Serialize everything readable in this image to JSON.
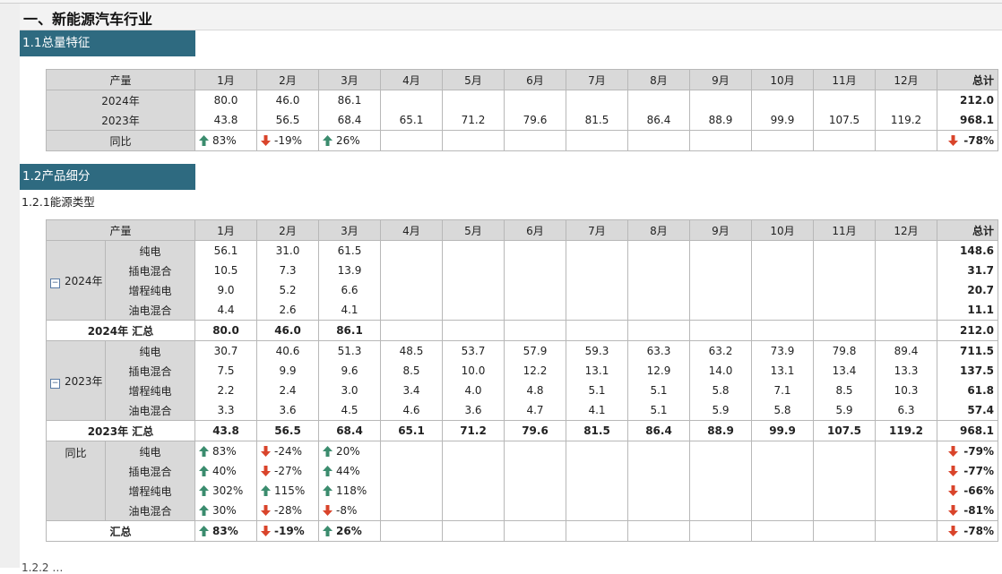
{
  "page_title": "一、新能源汽车行业",
  "section1": {
    "title": "1.1总量特征",
    "header": [
      "产量",
      "1月",
      "2月",
      "3月",
      "4月",
      "5月",
      "6月",
      "7月",
      "8月",
      "9月",
      "10月",
      "11月",
      "12月",
      "总计"
    ],
    "rows": [
      {
        "label": "2024年",
        "values": [
          "80.0",
          "46.0",
          "86.1",
          "",
          "",
          "",
          "",
          "",
          "",
          "",
          "",
          ""
        ],
        "total": "212.0"
      },
      {
        "label": "2023年",
        "values": [
          "43.8",
          "56.5",
          "68.4",
          "65.1",
          "71.2",
          "79.6",
          "81.5",
          "86.4",
          "88.9",
          "99.9",
          "107.5",
          "119.2"
        ],
        "total": "968.1"
      }
    ],
    "yoy": {
      "label": "同比",
      "values": [
        {
          "dir": "up",
          "text": "83%"
        },
        {
          "dir": "down",
          "text": "-19%"
        },
        {
          "dir": "up",
          "text": "26%"
        }
      ],
      "total": {
        "dir": "down",
        "text": "-78%"
      }
    }
  },
  "section2": {
    "title": "1.2产品细分",
    "subtitle": "1.2.1能源类型",
    "header": [
      "产量",
      "1月",
      "2月",
      "3月",
      "4月",
      "5月",
      "6月",
      "7月",
      "8月",
      "9月",
      "10月",
      "11月",
      "12月",
      "总计"
    ],
    "year2024": {
      "label": "2024年",
      "rows": [
        {
          "type": "纯电",
          "values": [
            "56.1",
            "31.0",
            "61.5",
            "",
            "",
            "",
            "",
            "",
            "",
            "",
            "",
            ""
          ],
          "total": "148.6"
        },
        {
          "type": "插电混合",
          "values": [
            "10.5",
            "7.3",
            "13.9",
            "",
            "",
            "",
            "",
            "",
            "",
            "",
            "",
            ""
          ],
          "total": "31.7"
        },
        {
          "type": "增程纯电",
          "values": [
            "9.0",
            "5.2",
            "6.6",
            "",
            "",
            "",
            "",
            "",
            "",
            "",
            "",
            ""
          ],
          "total": "20.7"
        },
        {
          "type": "油电混合",
          "values": [
            "4.4",
            "2.6",
            "4.1",
            "",
            "",
            "",
            "",
            "",
            "",
            "",
            "",
            ""
          ],
          "total": "11.1"
        }
      ],
      "summary": {
        "label": "2024年 汇总",
        "values": [
          "80.0",
          "46.0",
          "86.1",
          "",
          "",
          "",
          "",
          "",
          "",
          "",
          "",
          ""
        ],
        "total": "212.0"
      }
    },
    "year2023": {
      "label": "2023年",
      "rows": [
        {
          "type": "纯电",
          "values": [
            "30.7",
            "40.6",
            "51.3",
            "48.5",
            "53.7",
            "57.9",
            "59.3",
            "63.3",
            "63.2",
            "73.9",
            "79.8",
            "89.4"
          ],
          "total": "711.5"
        },
        {
          "type": "插电混合",
          "values": [
            "7.5",
            "9.9",
            "9.6",
            "8.5",
            "10.0",
            "12.2",
            "13.1",
            "12.9",
            "14.0",
            "13.1",
            "13.4",
            "13.3"
          ],
          "total": "137.5"
        },
        {
          "type": "增程纯电",
          "values": [
            "2.2",
            "2.4",
            "3.0",
            "3.4",
            "4.0",
            "4.8",
            "5.1",
            "5.1",
            "5.8",
            "7.1",
            "8.5",
            "10.3"
          ],
          "total": "61.8"
        },
        {
          "type": "油电混合",
          "values": [
            "3.3",
            "3.6",
            "4.5",
            "4.6",
            "3.6",
            "4.7",
            "4.1",
            "5.1",
            "5.9",
            "5.8",
            "5.9",
            "6.3"
          ],
          "total": "57.4"
        }
      ],
      "summary": {
        "label": "2023年 汇总",
        "values": [
          "43.8",
          "56.5",
          "68.4",
          "65.1",
          "71.2",
          "79.6",
          "81.5",
          "86.4",
          "88.9",
          "99.9",
          "107.5",
          "119.2"
        ],
        "total": "968.1"
      }
    },
    "yoy": {
      "label": "同比",
      "rows": [
        {
          "type": "纯电",
          "values": [
            {
              "dir": "up",
              "text": "83%"
            },
            {
              "dir": "down",
              "text": "-24%"
            },
            {
              "dir": "up",
              "text": "20%"
            }
          ],
          "total": {
            "dir": "down",
            "text": "-79%"
          }
        },
        {
          "type": "插电混合",
          "values": [
            {
              "dir": "up",
              "text": "40%"
            },
            {
              "dir": "down",
              "text": "-27%"
            },
            {
              "dir": "up",
              "text": "44%"
            }
          ],
          "total": {
            "dir": "down",
            "text": "-77%"
          }
        },
        {
          "type": "增程纯电",
          "values": [
            {
              "dir": "up",
              "text": "302%"
            },
            {
              "dir": "up",
              "text": "115%"
            },
            {
              "dir": "up",
              "text": "118%"
            }
          ],
          "total": {
            "dir": "down",
            "text": "-66%"
          }
        },
        {
          "type": "油电混合",
          "values": [
            {
              "dir": "up",
              "text": "30%"
            },
            {
              "dir": "down",
              "text": "-28%"
            },
            {
              "dir": "down",
              "text": "-8%"
            }
          ],
          "total": {
            "dir": "down",
            "text": "-81%"
          }
        }
      ],
      "summary": {
        "label": "汇总",
        "values": [
          {
            "dir": "up",
            "text": "83%"
          },
          {
            "dir": "down",
            "text": "-19%"
          },
          {
            "dir": "up",
            "text": "26%"
          }
        ],
        "total": {
          "dir": "down",
          "text": "-78%"
        }
      }
    }
  },
  "colors": {
    "section_bg": "#2e6a80",
    "up_arrow": "#3b8c6e",
    "down_arrow": "#d9442b",
    "header_bg": "#d9d9d9"
  },
  "icons": {
    "up": "arrow-up-icon",
    "down": "arrow-down-icon",
    "collapse": "collapse-minus-icon"
  }
}
